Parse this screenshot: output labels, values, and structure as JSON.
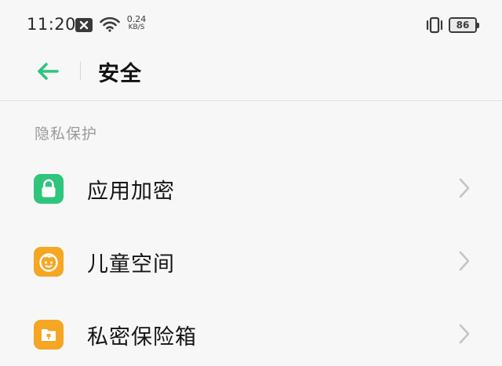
{
  "status_bar": {
    "time": "11:20",
    "net_speed_value": "0.24",
    "net_speed_unit": "KB/S",
    "battery": "86"
  },
  "header": {
    "title": "安全"
  },
  "section": {
    "label": "隐私保护",
    "items": [
      {
        "label": "应用加密",
        "icon": "lock-icon",
        "color": "#2fc57c"
      },
      {
        "label": "儿童空间",
        "icon": "child-face-icon",
        "color": "#f5a623"
      },
      {
        "label": "私密保险箱",
        "icon": "safe-folder-icon",
        "color": "#f5a623"
      }
    ]
  },
  "colors": {
    "accent": "#2fc57c",
    "orange": "#f5a623"
  }
}
